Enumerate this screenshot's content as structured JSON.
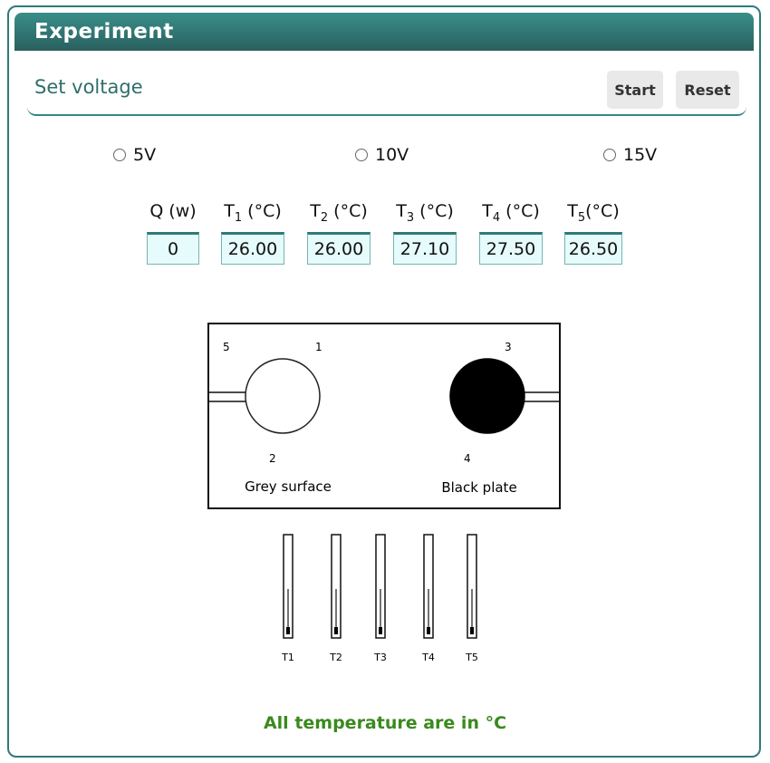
{
  "panel": {
    "title": "Experiment"
  },
  "toolbar": {
    "title": "Set voltage",
    "start_label": "Start",
    "reset_label": "Reset"
  },
  "voltage_options": [
    {
      "label": "5V",
      "selected": false
    },
    {
      "label": "10V",
      "selected": false
    },
    {
      "label": "15V",
      "selected": false
    }
  ],
  "readings": [
    {
      "label_main": "Q (w)",
      "label_sub": "",
      "label_unit": "",
      "value": "0"
    },
    {
      "label_main": "T",
      "label_sub": "1",
      "label_unit": " (°C)",
      "value": "26.00"
    },
    {
      "label_main": "T",
      "label_sub": "2",
      "label_unit": " (°C)",
      "value": "26.00"
    },
    {
      "label_main": "T",
      "label_sub": "3",
      "label_unit": " (°C)",
      "value": "27.10"
    },
    {
      "label_main": "T",
      "label_sub": "4",
      "label_unit": " (°C)",
      "value": "27.50"
    },
    {
      "label_main": "T",
      "label_sub": "5",
      "label_unit": "(°C)",
      "value": "26.50"
    }
  ],
  "diagram": {
    "sensor_numbers": [
      "5",
      "1",
      "3",
      "2",
      "4"
    ],
    "grey_label": "Grey surface",
    "black_label": "Black plate",
    "thermometers": [
      "T1",
      "T2",
      "T3",
      "T4",
      "T5"
    ]
  },
  "colors": {
    "accent": "#2e7b7b",
    "note": "#3a8a1e",
    "field_bg": "#e6fbfb"
  },
  "note": "All temperature are in °C"
}
